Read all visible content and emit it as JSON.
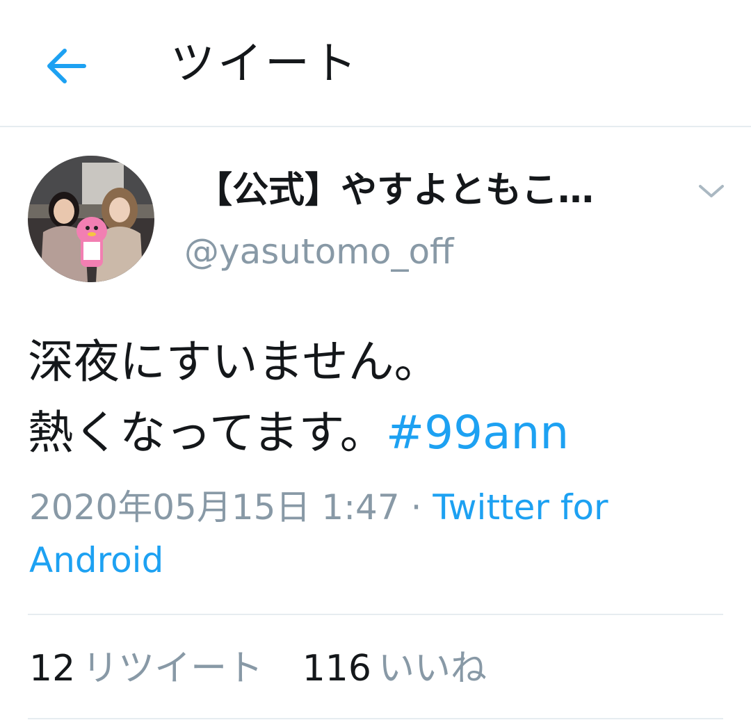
{
  "header": {
    "title": "ツイート",
    "back_icon": "arrow-left-icon"
  },
  "colors": {
    "accent": "#1da1f2",
    "secondary_text": "#8899a6",
    "primary_text": "#14171a",
    "divider": "#e6ecf0"
  },
  "tweet": {
    "display_name": "【公式】やすよともこ…",
    "handle": "@yasutomo_off",
    "text_line1": "深夜にすいません。",
    "text_line2": "熱くなってます。",
    "hashtag": "#99ann",
    "timestamp": "2020年05月15日 1:47",
    "separator": "·",
    "source": "Twitter for Android",
    "avatar_icon": "profile-avatar",
    "menu_icon": "chevron-down-icon"
  },
  "stats": {
    "retweets_count": "12",
    "retweets_label": "リツイート",
    "likes_count": "116",
    "likes_label": "いいね"
  }
}
